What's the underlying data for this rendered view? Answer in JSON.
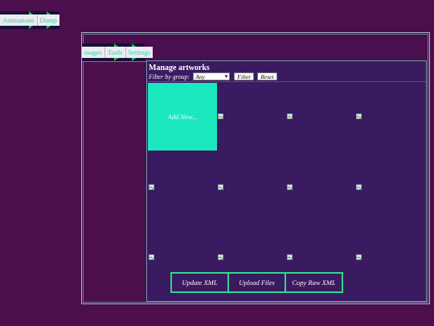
{
  "top_menu": {
    "items": [
      "Animations",
      "Dump"
    ]
  },
  "window": {
    "sub_menu": {
      "items": [
        "mages",
        "Tools",
        "Settings"
      ]
    },
    "panel": {
      "title": "Manage artworks",
      "filter_label": "Filter by group:",
      "filter_select_value": "Any",
      "filter_button": "Filter",
      "reset_button": "Reset",
      "add_new_label": "Add New...",
      "artwork_tiles": 11,
      "actions": [
        "Update XML",
        "Upload Files",
        "Copy Raw XML"
      ]
    }
  },
  "colors": {
    "background": "#4a0f4c",
    "panel": "#3a1a60",
    "accent": "#1ce8c0",
    "border_green": "#2fd88a"
  },
  "icons": [
    "broken-image-icon",
    "chevron-down-icon"
  ]
}
